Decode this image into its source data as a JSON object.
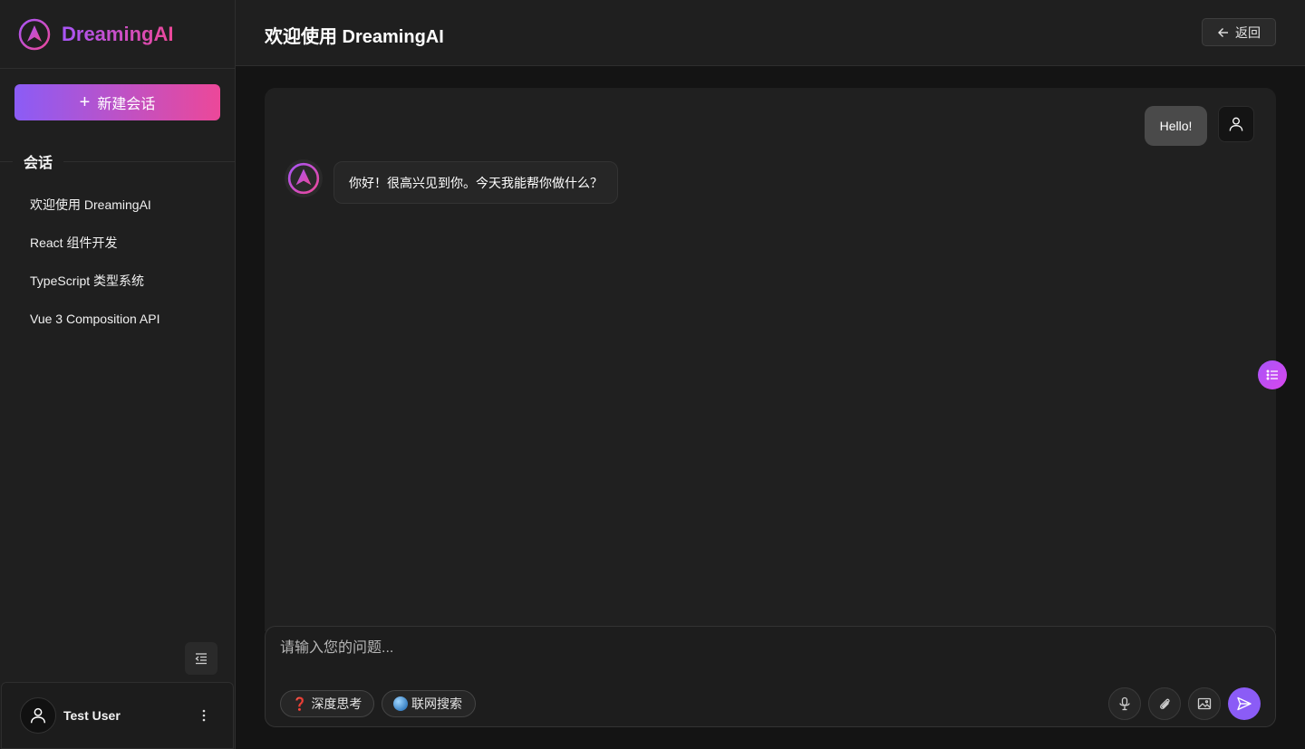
{
  "app": {
    "name": "DreamingAI"
  },
  "sidebar": {
    "new_chat_label": "新建会话",
    "section_title": "会话",
    "conversations": [
      {
        "title": "欢迎使用 DreamingAI"
      },
      {
        "title": "React 组件开发"
      },
      {
        "title": "TypeScript 类型系统"
      },
      {
        "title": "Vue 3 Composition API"
      }
    ],
    "user": {
      "name": "Test User"
    }
  },
  "header": {
    "title": "欢迎使用 DreamingAI",
    "back_label": "返回"
  },
  "chat": {
    "messages": [
      {
        "role": "user",
        "text": "Hello!"
      },
      {
        "role": "assistant",
        "text": "你好！很高兴见到你。今天我能帮你做什么？"
      }
    ]
  },
  "composer": {
    "placeholder": "请输入您的问题...",
    "chips": [
      {
        "label": "深度思考",
        "icon": "question-mark-icon"
      },
      {
        "label": "联网搜索",
        "icon": "globe-icon"
      }
    ]
  },
  "colors": {
    "accent": "#8b5cf6",
    "accent_pink": "#ec4899"
  }
}
